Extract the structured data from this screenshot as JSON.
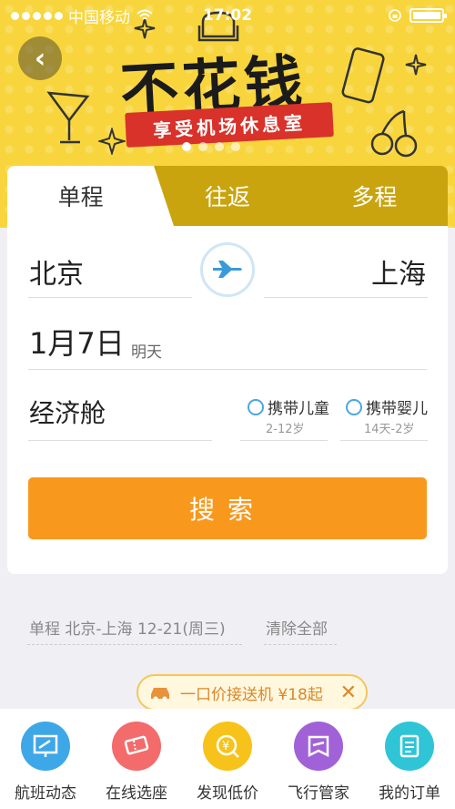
{
  "status_bar": {
    "carrier": "中国移动",
    "time": "17:02"
  },
  "banner": {
    "title": "不花钱",
    "subtitle": "享受机场休息室",
    "slides": 4,
    "active_slide": 1
  },
  "trip_tabs": [
    {
      "label": "单程",
      "active": true
    },
    {
      "label": "往返",
      "active": false
    },
    {
      "label": "多程",
      "active": false
    }
  ],
  "form": {
    "from_city": "北京",
    "to_city": "上海",
    "date": "1月7日",
    "date_hint": "明天",
    "cabin": "经济舱",
    "child": {
      "label": "携带儿童",
      "sub": "2-12岁"
    },
    "infant": {
      "label": "携带婴儿",
      "sub": "14天-2岁"
    },
    "search_label": "搜索"
  },
  "history": {
    "item": "单程 北京-上海 12-21(周三)",
    "clear_label": "清除全部"
  },
  "pickup": {
    "label": "一口价接送机 ¥18起"
  },
  "bottom_nav": [
    {
      "label": "航班动态",
      "icon": "flight-board-icon",
      "color": "#3ea7e8"
    },
    {
      "label": "在线选座",
      "icon": "ticket-icon",
      "color": "#f36b6b"
    },
    {
      "label": "发现低价",
      "icon": "yuan-coin-icon",
      "color": "#f7c31a"
    },
    {
      "label": "飞行管家",
      "icon": "flight-manager-icon",
      "color": "#a162d8"
    },
    {
      "label": "我的订单",
      "icon": "order-list-icon",
      "color": "#2fc5d6"
    }
  ],
  "colors": {
    "banner": "#f8d53c",
    "tab_bar": "#c9a40f",
    "search_button": "#f8981d",
    "accent_blue": "#4aa7e0"
  }
}
